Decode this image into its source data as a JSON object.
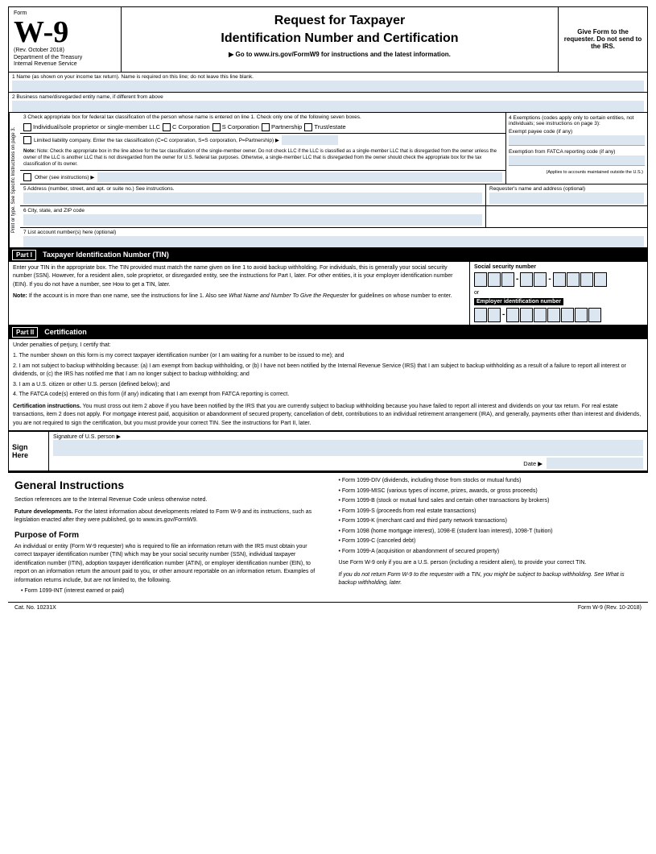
{
  "header": {
    "form_label": "Form",
    "form_name": "W-9",
    "rev_date": "(Rev. October 2018)",
    "dept": "Department of the Treasury",
    "irs": "Internal Revenue Service",
    "title_line1": "Request for Taxpayer",
    "title_line2": "Identification Number and Certification",
    "goto_text": "▶ Go to www.irs.gov/FormW9 for instructions and the latest information.",
    "give_form": "Give Form to the requester. Do not send to the IRS."
  },
  "fields": {
    "line1_label": "1  Name (as shown on your income tax return). Name is required on this line; do not leave this line blank.",
    "line2_label": "2  Business name/disregarded entity name, if different from above",
    "line3_label": "3  Check appropriate box for federal tax classification of the person whose name is entered on line 1. Check only one of the following seven boxes.",
    "line4_label": "4  Exemptions (codes apply only to certain entities, not individuals; see instructions on page 3):",
    "exempt_payee_label": "Exempt payee code (if any)",
    "fatca_label": "Exemption from FATCA reporting code (if any)",
    "applies_note": "(Applies to accounts maintained outside the U.S.)",
    "line5_label": "5  Address (number, street, and apt. or suite no.) See instructions.",
    "requesters_label": "Requester's name and address (optional)",
    "line6_label": "6  City, state, and ZIP code",
    "line7_label": "7  List account number(s) here (optional)"
  },
  "checkboxes": {
    "individual_label": "Individual/sole proprietor or single-member LLC",
    "c_corp_label": "C Corporation",
    "s_corp_label": "S Corporation",
    "partnership_label": "Partnership",
    "trust_label": "Trust/estate",
    "llc_label": "Limited liability company. Enter the tax classification (C=C corporation, S=S corporation, P=Partnership) ▶",
    "other_label": "Other (see instructions) ▶"
  },
  "notes": {
    "note_text": "Note: Check the appropriate box in the line above for the tax classification of the single-member owner. Do not check LLC if the LLC is classified as a single-member LLC that is disregarded from the owner unless the owner of the LLC is another LLC that is not disregarded from the owner for U.S. federal tax purposes. Otherwise, a single-member LLC that is disregarded from the owner should check the appropriate box for the tax classification of its owner."
  },
  "side_label": "Print or type. See Specific Instructions on page 3.",
  "part1": {
    "label": "Part I",
    "title": "Taxpayer Identification Number (TIN)",
    "body_text": "Enter your TIN in the appropriate box. The TIN provided must match the name given on line 1 to avoid backup withholding. For individuals, this is generally your social security number (SSN). However, for a resident alien, sole proprietor, or disregarded entity, see the instructions for Part I, later. For other entities, it is your employer identification number (EIN). If you do not have a number, see How to get a TIN, later.",
    "note_text": "Note: If the account is in more than one name, see the instructions for line 1. Also see What Name and Number To Give the Requester for guidelines on whose number to enter.",
    "ssn_label": "Social security number",
    "or_text": "or",
    "ein_label": "Employer identification number"
  },
  "part2": {
    "label": "Part II",
    "title": "Certification",
    "under_penalties": "Under penalties of perjury, I certify that:",
    "item1": "1. The number shown on this form is my correct taxpayer identification number (or I am waiting for a number to be issued to me); and",
    "item2": "2. I am not subject to backup withholding because: (a) I am exempt from backup withholding, or (b) I have not been notified by the Internal Revenue Service (IRS) that I am subject to backup withholding as a result of a failure to report all interest or dividends, or (c) the IRS has notified me that I am no longer subject to backup withholding; and",
    "item3": "3. I am a U.S. citizen or other U.S. person (defined below); and",
    "item4": "4. The FATCA code(s) entered on this form (if any) indicating that I am exempt from FATCA reporting is correct.",
    "cert_instructions_label": "Certification instructions.",
    "cert_instructions_text": "You must cross out item 2 above if you have been notified by the IRS that you are currently subject to backup withholding because you have failed to report all interest and dividends on your tax return. For real estate transactions, item 2 does not apply. For mortgage interest paid, acquisition or abandonment of secured property, cancellation of debt, contributions to an individual retirement arrangement (IRA), and generally, payments other than interest and dividends, you are not required to sign the certification, but you must provide your correct TIN. See the instructions for Part II, later."
  },
  "sign": {
    "sign_here": "Sign",
    "sign_here2": "Here",
    "sig_label": "Signature of U.S. person ▶",
    "date_label": "Date ▶"
  },
  "general_instructions": {
    "title": "General Instructions",
    "intro": "Section references are to the Internal Revenue Code unless otherwise noted.",
    "future_label": "Future developments.",
    "future_text": "For the latest information about developments related to Form W-9 and its instructions, such as legislation enacted after they were published, go to www.irs.gov/FormW9.",
    "purpose_title": "Purpose of Form",
    "purpose_text": "An individual or entity (Form W-9 requester) who is required to file an information return with the IRS must obtain your correct taxpayer identification number (TIN) which may be your social security number (SSN), individual taxpayer identification number (ITIN), adoption taxpayer identification number (ATIN), or employer identification number (EIN), to report on an information return the amount paid to you, or other amount reportable on an information return. Examples of information returns include, but are not limited to, the following.",
    "bullet1": "• Form 1099-INT (interest earned or paid)",
    "right_bullets": [
      "• Form 1099-DIV (dividends, including those from stocks or mutual funds)",
      "• Form 1099-MISC (various types of income, prizes, awards, or gross proceeds)",
      "• Form 1099-B (stock or mutual fund sales and certain other transactions by brokers)",
      "• Form 1099-S (proceeds from real estate transactions)",
      "• Form 1099-K (merchant card and third party network transactions)",
      "• Form 1098 (home mortgage interest), 1098-E (student loan interest), 1098-T (tuition)",
      "• Form 1099-C (canceled debt)",
      "• Form 1099-A (acquisition or abandonment of secured property)",
      "Use Form W-9 only if you are a U.S. person (including a resident alien), to provide your correct TIN.",
      "If you do not return Form W-9 to the requester with a TIN, you might be subject to backup withholding. See What is backup withholding, later."
    ]
  },
  "footer": {
    "cat_no": "Cat. No. 10231X",
    "form_label": "Form W-9 (Rev. 10-2018)"
  }
}
